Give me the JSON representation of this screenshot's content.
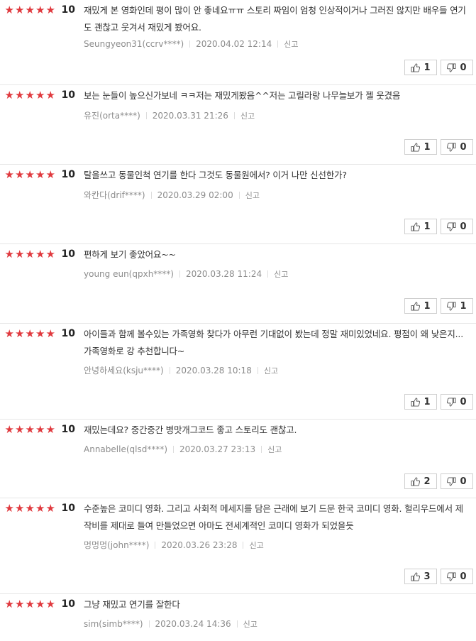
{
  "reviews": [
    {
      "stars": "★★★★★",
      "score": "10",
      "text": "재밌게 본 영화인데 평이 많이 안 좋네요ㅠㅠ 스토리 짜임이 엄청 인상적이거나 그러진 않지만 배우들 연기도 괜찮고 웃겨서 재밌게 봤어요.",
      "author": "Seungyeon31(ccrv****)",
      "date": "2020.04.02 12:14",
      "report": "신고",
      "likes": "1",
      "dislikes": "0"
    },
    {
      "stars": "★★★★★",
      "score": "10",
      "text": "보는 눈들이 높으신가보네 ㅋㅋ저는 재밌게봤음^^저는 고릴라랑 나무늘보가 젤 웃겼음",
      "author": "유진(orta****)",
      "date": "2020.03.31 21:26",
      "report": "신고",
      "likes": "1",
      "dislikes": "0"
    },
    {
      "stars": "★★★★★",
      "score": "10",
      "text": "탈을쓰고 동물인척 연기를 한다 그것도 동물원에서? 이거 나만 신선한가?",
      "author": "와칸다(drif****)",
      "date": "2020.03.29 02:00",
      "report": "신고",
      "likes": "1",
      "dislikes": "0"
    },
    {
      "stars": "★★★★★",
      "score": "10",
      "text": "편하게 보기 좋았어요~~",
      "author": "young eun(qpxh****)",
      "date": "2020.03.28 11:24",
      "report": "신고",
      "likes": "1",
      "dislikes": "1"
    },
    {
      "stars": "★★★★★",
      "score": "10",
      "text": "아이들과 함께 볼수있는 가족영화 찾다가 아무런 기대없이 봤는데 정말 재미있었네요. 평점이 왜 낮은지... 가족영화로 강 추천합니다~",
      "author": "안녕하세요(ksju****)",
      "date": "2020.03.28 10:18",
      "report": "신고",
      "likes": "1",
      "dislikes": "0"
    },
    {
      "stars": "★★★★★",
      "score": "10",
      "text": "재밌는데요? 중간중간 병맛개그코드 좋고 스토리도 괜찮고.",
      "author": "Annabelle(qlsd****)",
      "date": "2020.03.27 23:13",
      "report": "신고",
      "likes": "2",
      "dislikes": "0"
    },
    {
      "stars": "★★★★★",
      "score": "10",
      "text": "수준높은 코미디 영화. 그리고 사회적 메세지를 담은 근래에 보기 드문 한국 코미디 영화. 헐리우드에서 제작비를 제대로 들여 만들었으면 아마도 전세계적인 코미디 영화가 되었을듯",
      "author": "멍멍멍(john****)",
      "date": "2020.03.26 23:28",
      "report": "신고",
      "likes": "3",
      "dislikes": "0"
    },
    {
      "stars": "★★★★★",
      "score": "10",
      "text": "그냥 재밌고 연기를 잘한다",
      "author": "sim(simb****)",
      "date": "2020.03.24 14:36",
      "report": "신고"
    }
  ]
}
